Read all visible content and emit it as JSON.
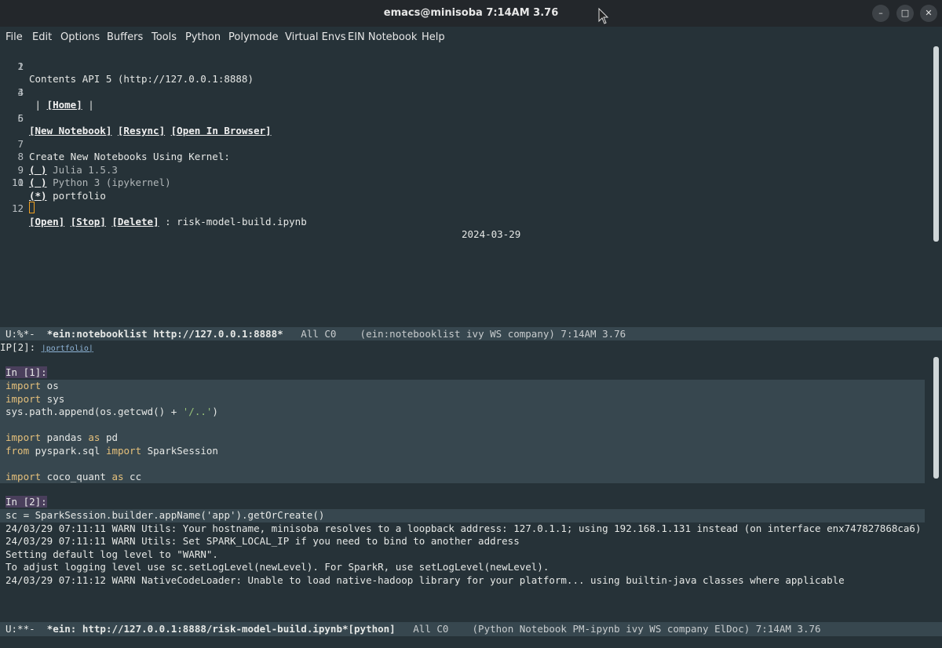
{
  "window": {
    "title": "emacs@minisoba 7:14AM 3.76"
  },
  "menu": [
    "File",
    "Edit",
    "Options",
    "Buffers",
    "Tools",
    "Python",
    "Polymode",
    "Virtual Envs",
    "EIN Notebook",
    "Help"
  ],
  "notebooklist": {
    "line1": "Contents API 5 (http://127.0.0.1:8888)",
    "home_prefix": " | ",
    "home": "[Home]",
    "home_suffix": " |",
    "new_notebook": "[New Notebook]",
    "resync": "[Resync]",
    "open_browser": "[Open In Browser]",
    "create_label": "Create New Notebooks Using Kernel:",
    "kernels": [
      {
        "radio": "( )",
        "name": "Julia 1.5.3"
      },
      {
        "radio": "( )",
        "name": "Python 3 (ipykernel)"
      },
      {
        "radio": "(*)",
        "name": "portfolio"
      }
    ],
    "open": "[Open]",
    "stop": "[Stop]",
    "delete": "[Delete]",
    "file": " : risk-model-build.ipynb",
    "date": "2024-03-29",
    "line_numbers": [
      "1",
      "2",
      "3",
      "4",
      "5",
      "6",
      "7",
      "8",
      "9",
      "10",
      "11",
      "12"
    ]
  },
  "modeline1": {
    "state": "U:%*-  ",
    "buffer": "*ein:notebooklist http://127.0.0.1:8888*",
    "rest": "   All C0    (ein:notebooklist ivy WS company) 7:14AM 3.76"
  },
  "header2": {
    "ip": "IP[2]: ",
    "tag": "|portfolio|"
  },
  "cells": {
    "cell1_prompt": "In [1]:",
    "cell2_prompt": "In [2]:",
    "cell2_code": "sc = SparkSession.builder.appName('app').getOrCreate()",
    "output": [
      "24/03/29 07:11:11 WARN Utils: Your hostname, minisoba resolves to a loopback address: 127.0.1.1; using 192.168.1.131 instead (on interface enx747827868ca6)",
      "24/03/29 07:11:11 WARN Utils: Set SPARK_LOCAL_IP if you need to bind to another address",
      "Setting default log level to \"WARN\".",
      "To adjust logging level use sc.setLogLevel(newLevel). For SparkR, use setLogLevel(newLevel).",
      "24/03/29 07:11:12 WARN NativeCodeLoader: Unable to load native-hadoop library for your platform... using builtin-java classes where applicable"
    ]
  },
  "modeline2": {
    "state": "U:**-  ",
    "buffer": "*ein: http://127.0.0.1:8888/risk-model-build.ipynb*[python]",
    "rest": "   All C0    (Python Notebook PM-ipynb ivy WS company ElDoc) 7:14AM 3.76"
  },
  "icons": {
    "minimize": "minimize-icon",
    "maximize": "maximize-icon",
    "close": "close-icon"
  }
}
